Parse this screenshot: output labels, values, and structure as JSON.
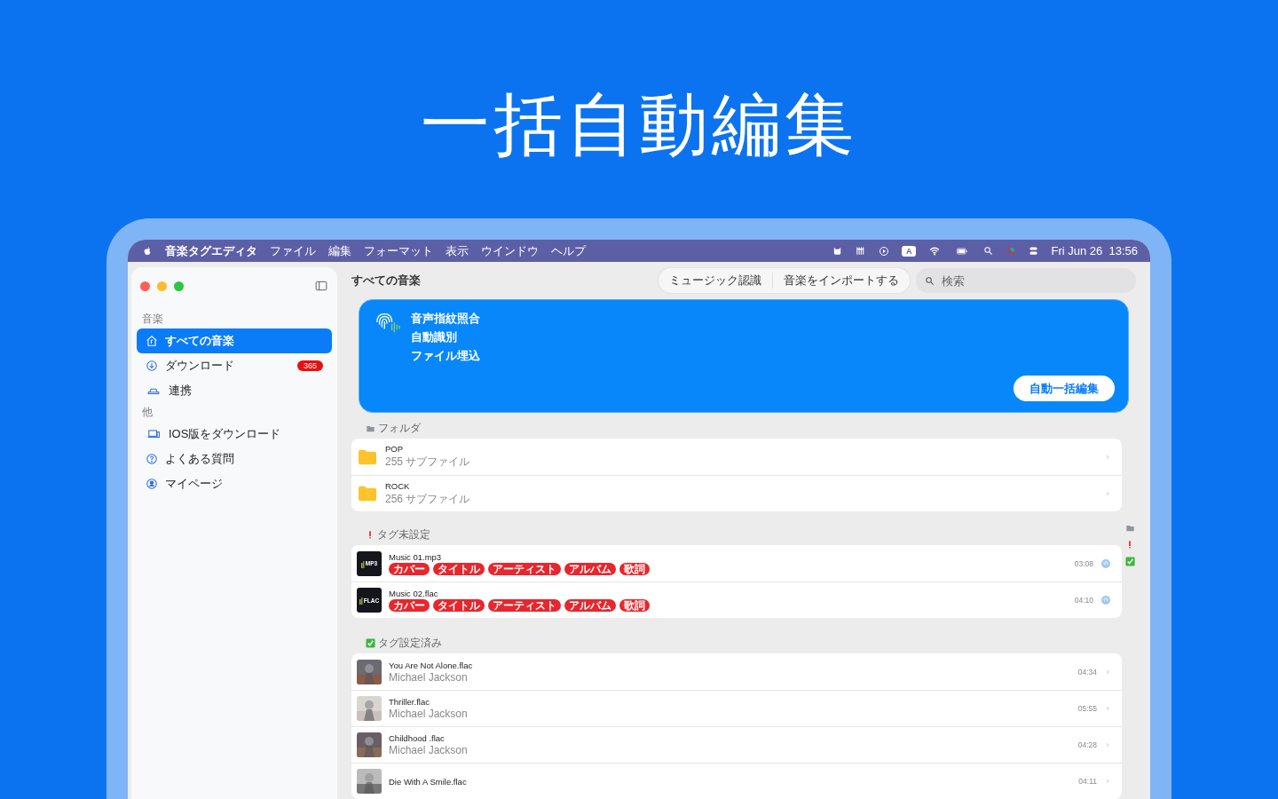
{
  "headline": "一括自動編集",
  "menubar": {
    "app": "音楽タグエディタ",
    "menus": [
      "ファイル",
      "編集",
      "フォーマット",
      "表示",
      "ウインドウ",
      "ヘルプ"
    ],
    "input_source": "A",
    "clock": "Fri Jun 26  13:56"
  },
  "sidebar": {
    "sections": [
      {
        "title": "音楽",
        "items": [
          {
            "label": "すべての音楽",
            "selected": true
          },
          {
            "label": "ダウンロード",
            "badge": "365",
            "selected": false
          },
          {
            "label": "連携",
            "selected": false
          }
        ]
      },
      {
        "title": "他",
        "items": [
          {
            "label": "IOS版をダウンロード",
            "selected": false
          },
          {
            "label": "よくある質問",
            "selected": false
          },
          {
            "label": "マイページ",
            "selected": false
          }
        ]
      }
    ]
  },
  "toolbar": {
    "title": "すべての音楽",
    "buttons": [
      "ミュージック認識",
      "音楽をインポートする"
    ],
    "search": {
      "placeholder": "検索"
    }
  },
  "banner": {
    "lines": [
      "音声指紋照合",
      "自動識別",
      "ファイル埋込"
    ],
    "button": "自動一括編集"
  },
  "folders": {
    "title": "フォルダ",
    "items": [
      {
        "name": "POP",
        "subtitle": "255 サブファイル"
      },
      {
        "name": "ROCK",
        "subtitle": "256 サブファイル"
      }
    ]
  },
  "untagged": {
    "title": "タグ未設定",
    "items": [
      {
        "name": "Music 01.mp3",
        "format": "MP3",
        "missing_tags": [
          "カバー",
          "タイトル",
          "アーティスト",
          "アルバム",
          "歌詞"
        ],
        "duration": "03:08"
      },
      {
        "name": "Music 02.flac",
        "format": "FLAC",
        "missing_tags": [
          "カバー",
          "タイトル",
          "アーティスト",
          "アルバム",
          "歌詞"
        ],
        "duration": "04:10"
      }
    ]
  },
  "tagged": {
    "title": "タグ設定済み",
    "items": [
      {
        "name": "You Are Not Alone.flac",
        "artist": "Michael Jackson",
        "duration": "04:34"
      },
      {
        "name": "Thriller.flac",
        "artist": "Michael Jackson",
        "duration": "05:55"
      },
      {
        "name": "Childhood .flac",
        "artist": "Michael Jackson",
        "duration": "04:28"
      },
      {
        "name": "Die With A Smile.flac",
        "duration": "04:11"
      }
    ]
  }
}
